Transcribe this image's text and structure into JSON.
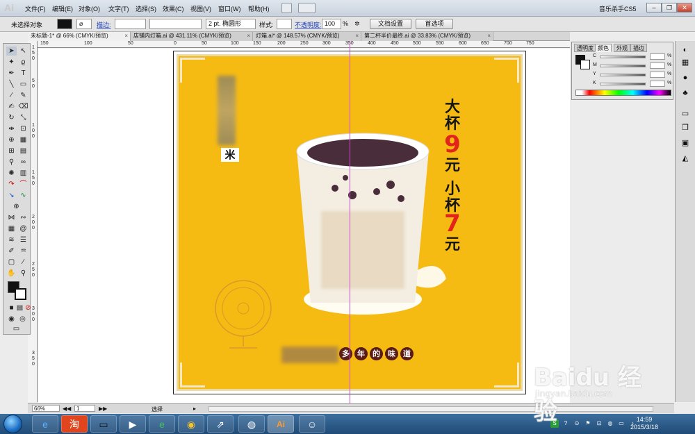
{
  "app": {
    "logo": "Ai",
    "workspace": "音乐杀手CS5",
    "menu": [
      "文件(F)",
      "编辑(E)",
      "对象(O)",
      "文字(T)",
      "选择(S)",
      "效果(C)",
      "视图(V)",
      "窗口(W)",
      "帮助(H)"
    ]
  },
  "control_bar": {
    "selection": "未选择对象",
    "stroke_label": "描边:",
    "stroke_value": "2 pt. 椭圆形",
    "style_label": "样式:",
    "opacity_label": "不透明度:",
    "opacity_value": "100",
    "opacity_unit": "%",
    "doc_setup_button": "文档设置",
    "preferences_button": "首选项"
  },
  "tabs": [
    {
      "label": "未标题-1* @ 66% (CMYK/预览)",
      "active": true
    },
    {
      "label": "店铺内灯箱.ai @ 431.11% (CMYK/预览)",
      "active": false
    },
    {
      "label": "灯箱.ai* @ 148.57% (CMYK/预览)",
      "active": false
    },
    {
      "label": "第二杯半价最终.ai @ 33.83% (CMYK/预览)",
      "active": false
    }
  ],
  "ruler": {
    "h_ticks": [
      "150",
      "100",
      "50",
      "0",
      "50",
      "100",
      "150",
      "200",
      "250",
      "300",
      "350",
      "400",
      "450",
      "500",
      "550",
      "600",
      "650",
      "700",
      "750"
    ],
    "v_ticks": [
      "1",
      "5",
      "0",
      "5",
      "0",
      "1",
      "0",
      "0",
      "1",
      "5",
      "0",
      "2",
      "0",
      "0",
      "2",
      "5",
      "0",
      "3",
      "0",
      "0",
      "3",
      "5",
      "0"
    ]
  },
  "poster": {
    "big_cup_label": "大杯",
    "big_cup_price": "9",
    "yuan": "元",
    "small_cup_label": "小杯",
    "small_cup_price": "7",
    "side_char": "米",
    "taste_chars": [
      "多",
      "年",
      "的",
      "味",
      "道"
    ],
    "bg_color": "#f6bb12",
    "price_color": "#e2241b"
  },
  "color_panel": {
    "tabs": [
      "透明度",
      "颜色",
      "外观",
      "描边"
    ],
    "channels": [
      "C",
      "M",
      "Y",
      "K"
    ],
    "percent": "%"
  },
  "status_bar": {
    "zoom": "66%",
    "page": "1",
    "mode": "选择"
  },
  "taskbar": {
    "time": "14:59",
    "date": "2015/3/18"
  },
  "watermark": {
    "brand": "Baidu 经验",
    "url": "jingyan.baidu.com"
  }
}
